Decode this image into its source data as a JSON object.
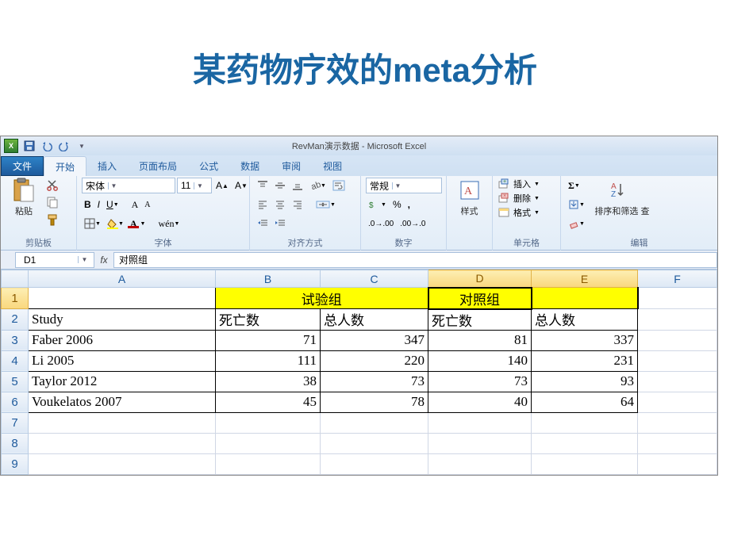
{
  "slide": {
    "title": "某药物疗效的meta分析"
  },
  "titlebar": {
    "doc": "RevMan演示数据",
    "app": "Microsoft Excel"
  },
  "qat": {
    "save": "save-icon",
    "undo": "undo-icon",
    "redo": "redo-icon"
  },
  "tabs": {
    "file": "文件",
    "home": "开始",
    "insert": "插入",
    "layout": "页面布局",
    "formulas": "公式",
    "data": "数据",
    "review": "审阅",
    "view": "视图"
  },
  "ribbon": {
    "clipboard": {
      "label": "剪贴板",
      "paste": "粘贴"
    },
    "font": {
      "label": "字体",
      "name": "宋体",
      "size": "11"
    },
    "alignment": {
      "label": "对齐方式"
    },
    "number": {
      "label": "数字",
      "format": "常规"
    },
    "styles": {
      "label": "样式",
      "btn": "样式"
    },
    "cells": {
      "label": "单元格",
      "insert": "插入",
      "delete": "删除",
      "format": "格式"
    },
    "editing": {
      "label": "编辑",
      "sortfind": "排序和筛选 查"
    }
  },
  "formula": {
    "cellref": "D1",
    "fx": "fx",
    "value": "对照组"
  },
  "columns": [
    "A",
    "B",
    "C",
    "D",
    "E",
    "F"
  ],
  "rows": [
    "1",
    "2",
    "3",
    "4",
    "5",
    "6",
    "7",
    "8",
    "9"
  ],
  "data": {
    "bc1": "试验组",
    "de1": "对照组",
    "a2": "Study",
    "b2": "死亡数",
    "c2": "总人数",
    "d2": "死亡数",
    "e2": "总人数",
    "a3": "Faber 2006",
    "b3": "71",
    "c3": "347",
    "d3": "81",
    "e3": "337",
    "a4": "Li 2005",
    "b4": "111",
    "c4": "220",
    "d4": "140",
    "e4": "231",
    "a5": "Taylor 2012",
    "b5": "38",
    "c5": "73",
    "d5": "73",
    "e5": "93",
    "a6": "Voukelatos 2007",
    "b6": "45",
    "c6": "78",
    "d6": "40",
    "e6": "64"
  },
  "chart_data": {
    "type": "table",
    "title": "某药物疗效的meta分析",
    "columns": [
      "Study",
      "试验组-死亡数",
      "试验组-总人数",
      "对照组-死亡数",
      "对照组-总人数"
    ],
    "rows": [
      [
        "Faber 2006",
        71,
        347,
        81,
        337
      ],
      [
        "Li 2005",
        111,
        220,
        140,
        231
      ],
      [
        "Taylor 2012",
        38,
        73,
        73,
        93
      ],
      [
        "Voukelatos 2007",
        45,
        78,
        40,
        64
      ]
    ]
  }
}
